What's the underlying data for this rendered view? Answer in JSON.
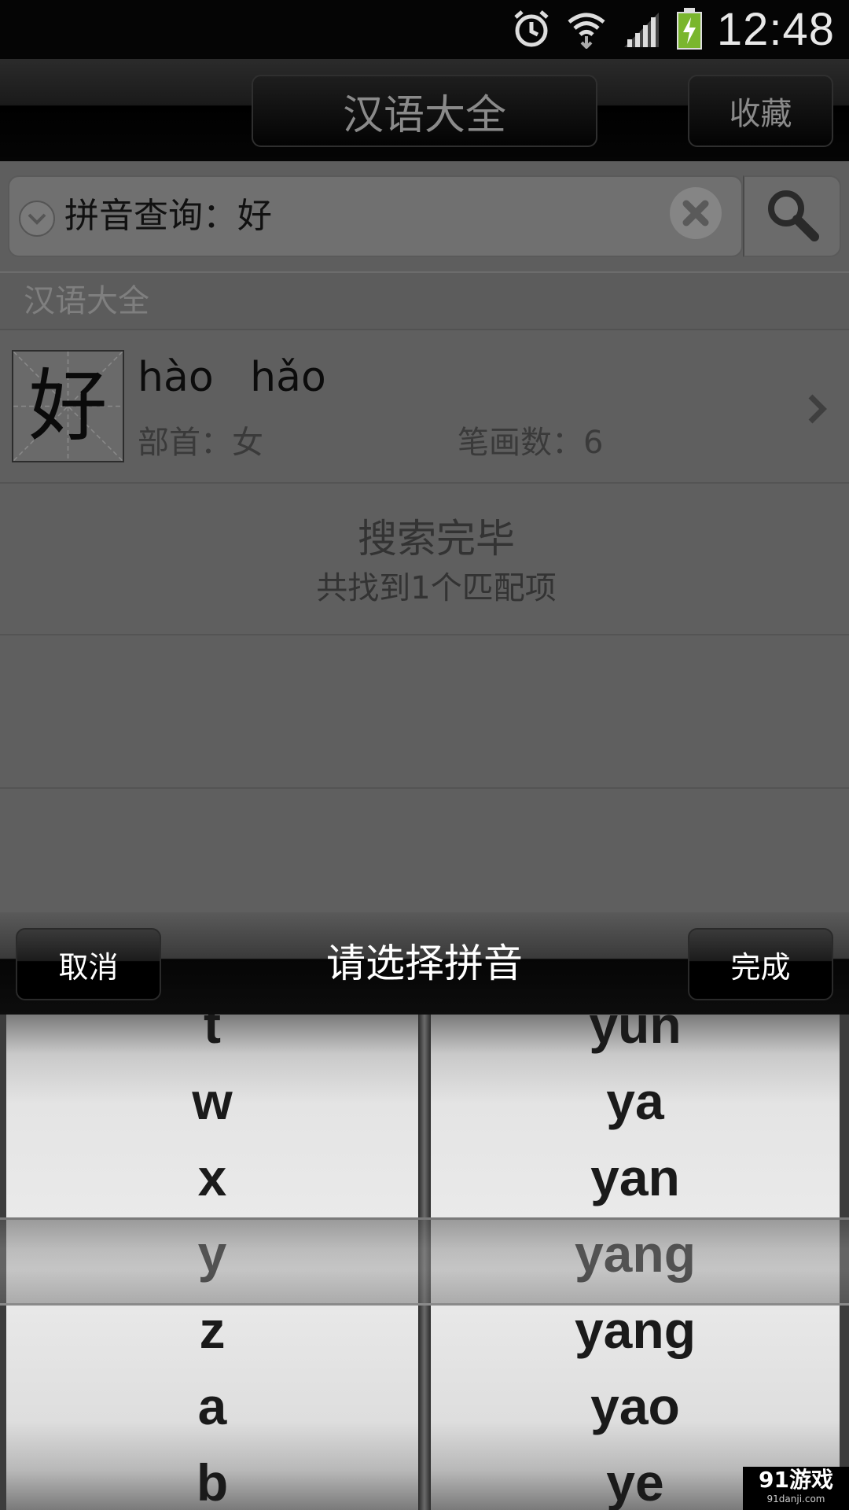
{
  "status_bar": {
    "time": "12:48",
    "icons": [
      "alarm-icon",
      "wifi-icon",
      "signal-icon",
      "battery-charging-icon"
    ]
  },
  "app_bar": {
    "title": "汉语大全",
    "favorites_label": "收藏"
  },
  "search": {
    "query_text": "拼音查询：好",
    "icons": [
      "dropdown-icon",
      "clear-icon",
      "search-icon"
    ]
  },
  "section": {
    "header": "汉语大全"
  },
  "results": [
    {
      "character": "好",
      "pinyin": "hào  hǎo",
      "radical": "部首：女",
      "strokes": "笔画数：6"
    }
  ],
  "search_status": {
    "title": "搜索完毕",
    "subtitle": "共找到1个匹配项"
  },
  "picker_bar": {
    "cancel_label": "取消",
    "title": "请选择拼音",
    "done_label": "完成"
  },
  "picker": {
    "left_items": [
      "t",
      "w",
      "x",
      "y",
      "z",
      "a",
      "b"
    ],
    "right_items": [
      "yun",
      "ya",
      "yan",
      "yang",
      "yang",
      "yao",
      "ye"
    ],
    "selected_left": "y",
    "selected_right": "yang"
  },
  "watermark": {
    "main": "91游戏",
    "sub": "91danji.com"
  }
}
